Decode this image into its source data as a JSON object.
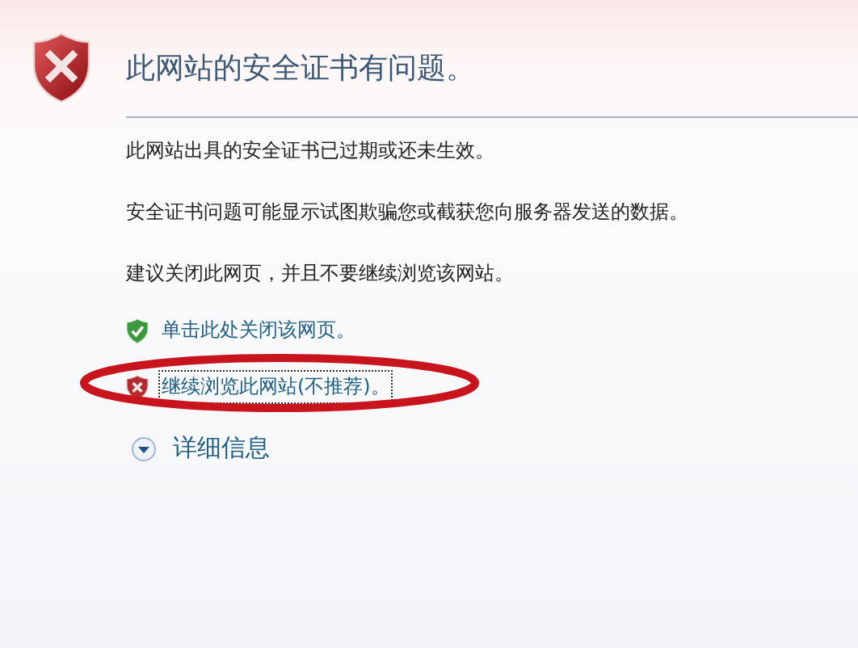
{
  "title": "此网站的安全证书有问题。",
  "paragraphs": [
    "此网站出具的安全证书已过期或还未生效。",
    "安全证书问题可能显示试图欺骗您或截获您向服务器发送的数据。",
    "建议关闭此网页，并且不要继续浏览该网站。"
  ],
  "links": [
    {
      "kind": "safe",
      "label": "单击此处关闭该网页。",
      "focused": false,
      "circled": false
    },
    {
      "kind": "unsafe",
      "label": "继续浏览此网站(不推荐)。",
      "focused": true,
      "circled": true
    }
  ],
  "details": {
    "label": "详细信息",
    "expanded": false
  }
}
